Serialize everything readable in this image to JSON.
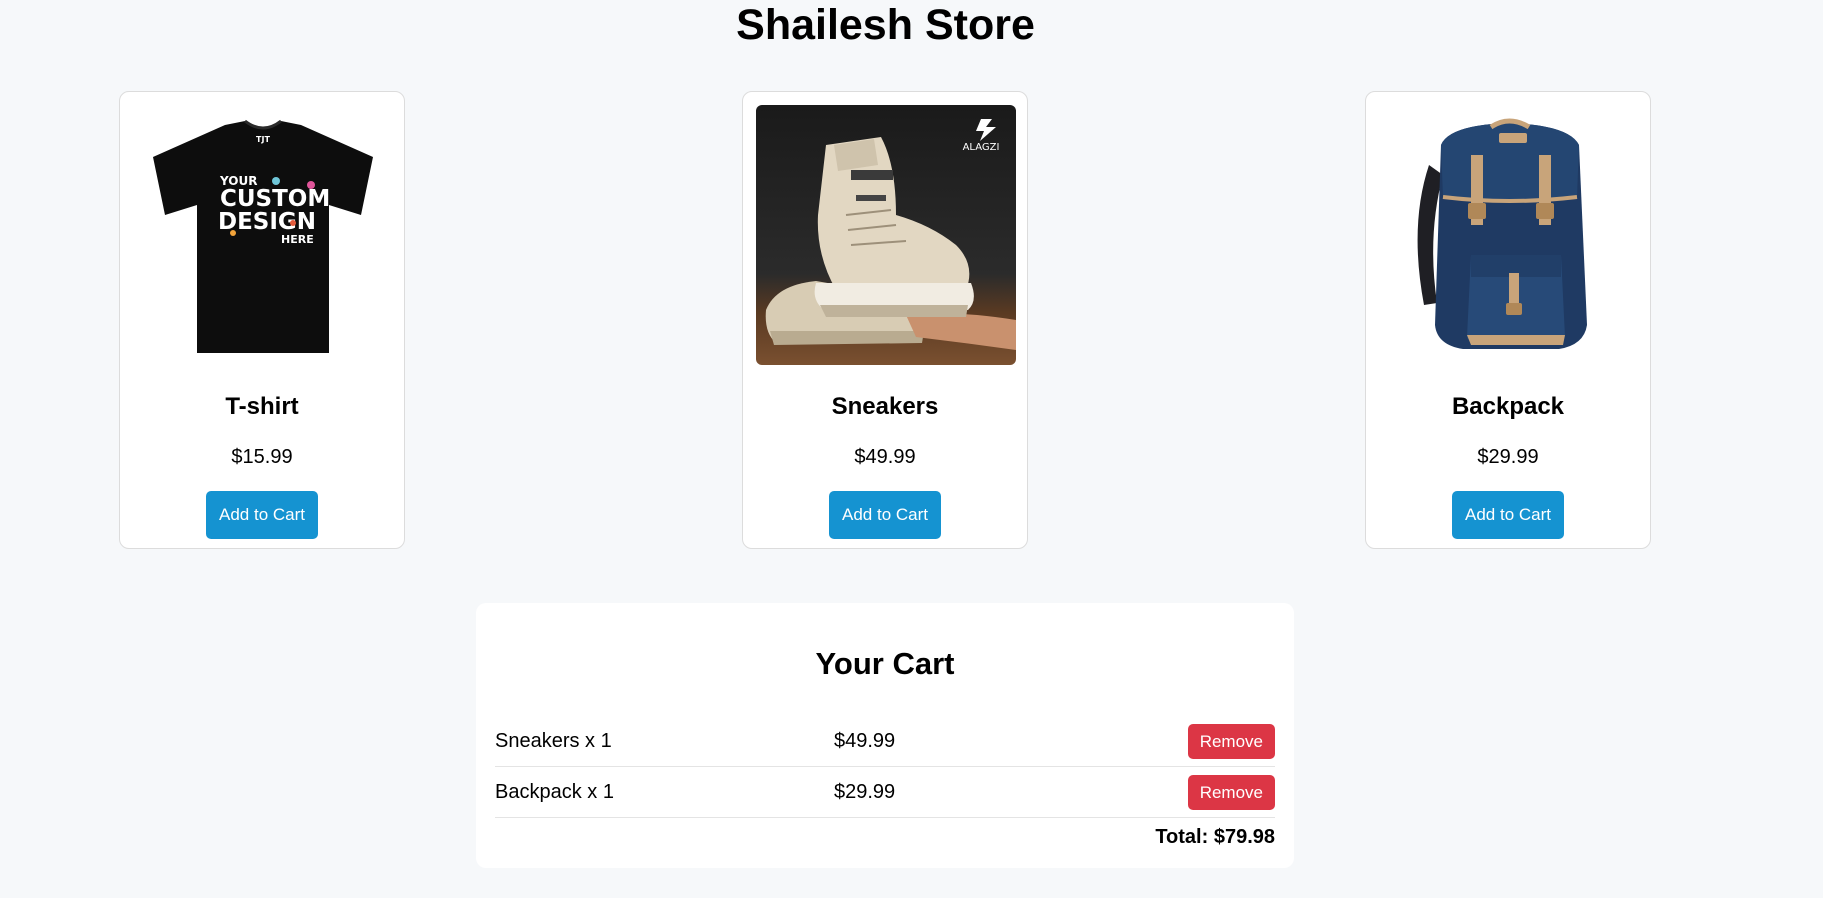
{
  "store": {
    "title": "Shailesh Store"
  },
  "products": [
    {
      "name": "T-shirt",
      "price": "$15.99",
      "button_label": "Add to Cart",
      "image_icon": "tshirt-image",
      "print_text": [
        "YOUR",
        "CUSTOM",
        "DESIGN",
        "HERE"
      ]
    },
    {
      "name": "Sneakers",
      "price": "$49.99",
      "button_label": "Add to Cart",
      "image_icon": "sneakers-image",
      "brand_text": "ALAGZI"
    },
    {
      "name": "Backpack",
      "price": "$29.99",
      "button_label": "Add to Cart",
      "image_icon": "backpack-image"
    }
  ],
  "cart": {
    "title": "Your Cart",
    "items": [
      {
        "label": "Sneakers x 1",
        "price": "$49.99",
        "remove_label": "Remove"
      },
      {
        "label": "Backpack x 1",
        "price": "$29.99",
        "remove_label": "Remove"
      }
    ],
    "total": "Total: $79.98"
  },
  "colors": {
    "background": "#f6f8fa",
    "add_button": "#1593d1",
    "remove_button": "#dc3645"
  }
}
